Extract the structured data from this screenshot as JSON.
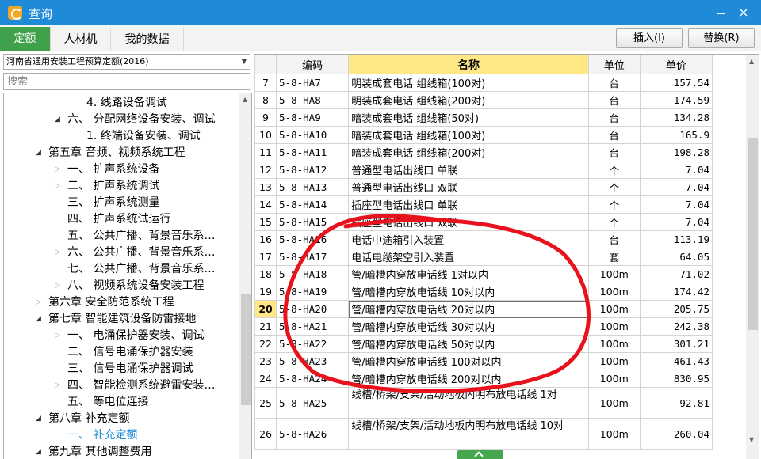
{
  "window": {
    "title": "查询",
    "minimize": "",
    "close": "×"
  },
  "tabs": [
    {
      "label": "定额",
      "active": true
    },
    {
      "label": "人材机",
      "active": false
    },
    {
      "label": "我的数据",
      "active": false
    }
  ],
  "toolbar": {
    "insert_label": "插入(I)",
    "replace_label": "替换(R)"
  },
  "left": {
    "library_select": "河南省通用安装工程预算定额(2016)",
    "search_placeholder": "搜索",
    "tree": [
      {
        "label": "4.  线路设备调试",
        "indent": 104,
        "toggle": ""
      },
      {
        "label": "六、  分配网络设备安装、调试",
        "indent": 80,
        "toggle": "exp"
      },
      {
        "label": "1.  终端设备安装、调试",
        "indent": 104,
        "toggle": ""
      },
      {
        "label": "第五章 音频、视频系统工程",
        "indent": 56,
        "toggle": "exp"
      },
      {
        "label": "一、  扩声系统设备",
        "indent": 80,
        "toggle": "col"
      },
      {
        "label": "二、  扩声系统调试",
        "indent": 80,
        "toggle": "col"
      },
      {
        "label": "三、  扩声系统测量",
        "indent": 80,
        "toggle": ""
      },
      {
        "label": "四、  扩声系统试运行",
        "indent": 80,
        "toggle": ""
      },
      {
        "label": "五、  公共广播、背景音乐系…",
        "indent": 80,
        "toggle": ""
      },
      {
        "label": "六、  公共广播、背景音乐系…",
        "indent": 80,
        "toggle": "col"
      },
      {
        "label": "七、  公共广播、背景音乐系…",
        "indent": 80,
        "toggle": ""
      },
      {
        "label": "八、  视频系统设备安装工程",
        "indent": 80,
        "toggle": "col"
      },
      {
        "label": "第六章 安全防范系统工程",
        "indent": 56,
        "toggle": "col"
      },
      {
        "label": "第七章 智能建筑设备防雷接地",
        "indent": 56,
        "toggle": "exp"
      },
      {
        "label": "一、  电涌保护器安装、调试",
        "indent": 80,
        "toggle": "col"
      },
      {
        "label": "二、  信号电涌保护器安装",
        "indent": 80,
        "toggle": ""
      },
      {
        "label": "三、  信号电涌保护器调试",
        "indent": 80,
        "toggle": ""
      },
      {
        "label": "四、  智能检测系统避雷安装…",
        "indent": 80,
        "toggle": "col"
      },
      {
        "label": "五、  等电位连接",
        "indent": 80,
        "toggle": ""
      },
      {
        "label": "第八章 补充定额",
        "indent": 56,
        "toggle": "exp"
      },
      {
        "label": "一、  补充定额",
        "indent": 80,
        "toggle": "",
        "selected": true
      },
      {
        "label": "第九章 其他调整费用",
        "indent": 56,
        "toggle": "exp"
      }
    ]
  },
  "grid": {
    "headers": {
      "no": "",
      "code": "编码",
      "name": "名称",
      "unit": "单位",
      "price": "单价"
    },
    "rows": [
      {
        "no": "7",
        "code": "5-8-HA7",
        "name": "明装成套电话 组线箱(100对)",
        "unit": "台",
        "price": "157.54"
      },
      {
        "no": "8",
        "code": "5-8-HA8",
        "name": "明装成套电话 组线箱(200对)",
        "unit": "台",
        "price": "174.59"
      },
      {
        "no": "9",
        "code": "5-8-HA9",
        "name": "暗装成套电话 组线箱(50对)",
        "unit": "台",
        "price": "134.28"
      },
      {
        "no": "10",
        "code": "5-8-HA10",
        "name": "暗装成套电话 组线箱(100对)",
        "unit": "台",
        "price": "165.9"
      },
      {
        "no": "11",
        "code": "5-8-HA11",
        "name": "暗装成套电话 组线箱(200对)",
        "unit": "台",
        "price": "198.28"
      },
      {
        "no": "12",
        "code": "5-8-HA12",
        "name": "普通型电话出线口 单联",
        "unit": "个",
        "price": "7.04"
      },
      {
        "no": "13",
        "code": "5-8-HA13",
        "name": "普通型电话出线口 双联",
        "unit": "个",
        "price": "7.04"
      },
      {
        "no": "14",
        "code": "5-8-HA14",
        "name": "插座型电话出线口 单联",
        "unit": "个",
        "price": "7.04"
      },
      {
        "no": "15",
        "code": "5-8-HA15",
        "name": "插座型电话出线口 双联",
        "unit": "个",
        "price": "7.04"
      },
      {
        "no": "16",
        "code": "5-8-HA16",
        "name": "电话中途箱引入装置",
        "unit": "台",
        "price": "113.19"
      },
      {
        "no": "17",
        "code": "5-8-HA17",
        "name": "电话电缆架空引入装置",
        "unit": "套",
        "price": "64.05"
      },
      {
        "no": "18",
        "code": "5-8-HA18",
        "name": "管/暗槽内穿放电话线 1对以内",
        "unit": "100m",
        "price": "71.02"
      },
      {
        "no": "19",
        "code": "5-8-HA19",
        "name": "管/暗槽内穿放电话线 10对以内",
        "unit": "100m",
        "price": "174.42"
      },
      {
        "no": "20",
        "code": "5-8-HA20",
        "name": "管/暗槽内穿放电话线 20对以内",
        "unit": "100m",
        "price": "205.75",
        "selected": true
      },
      {
        "no": "21",
        "code": "5-8-HA21",
        "name": "管/暗槽内穿放电话线 30对以内",
        "unit": "100m",
        "price": "242.38"
      },
      {
        "no": "22",
        "code": "5-8-HA22",
        "name": "管/暗槽内穿放电话线 50对以内",
        "unit": "100m",
        "price": "301.21"
      },
      {
        "no": "23",
        "code": "5-8-HA23",
        "name": "管/暗槽内穿放电话线 100对以内",
        "unit": "100m",
        "price": "461.43"
      },
      {
        "no": "24",
        "code": "5-8-HA24",
        "name": "管/暗槽内穿放电话线 200对以内",
        "unit": "100m",
        "price": "830.95"
      },
      {
        "no": "25",
        "code": "5-8-HA25",
        "name": "线槽/桥架/支架/活动地板内明布放电话线 1对",
        "unit": "100m",
        "price": "92.81",
        "tall": true
      },
      {
        "no": "26",
        "code": "5-8-HA26",
        "name": "线槽/桥架/支架/活动地板内明布放电话线 10对",
        "unit": "100m",
        "price": "260.04",
        "tall": true
      }
    ]
  },
  "colors": {
    "titlebar": "#1e8ad8",
    "tab_active": "#3fa24a",
    "header_highlight": "#ffe785",
    "annotation": "#e8121c"
  },
  "icons": {
    "app": "app-logo-icon",
    "dropdown": "chevron-down-icon"
  }
}
